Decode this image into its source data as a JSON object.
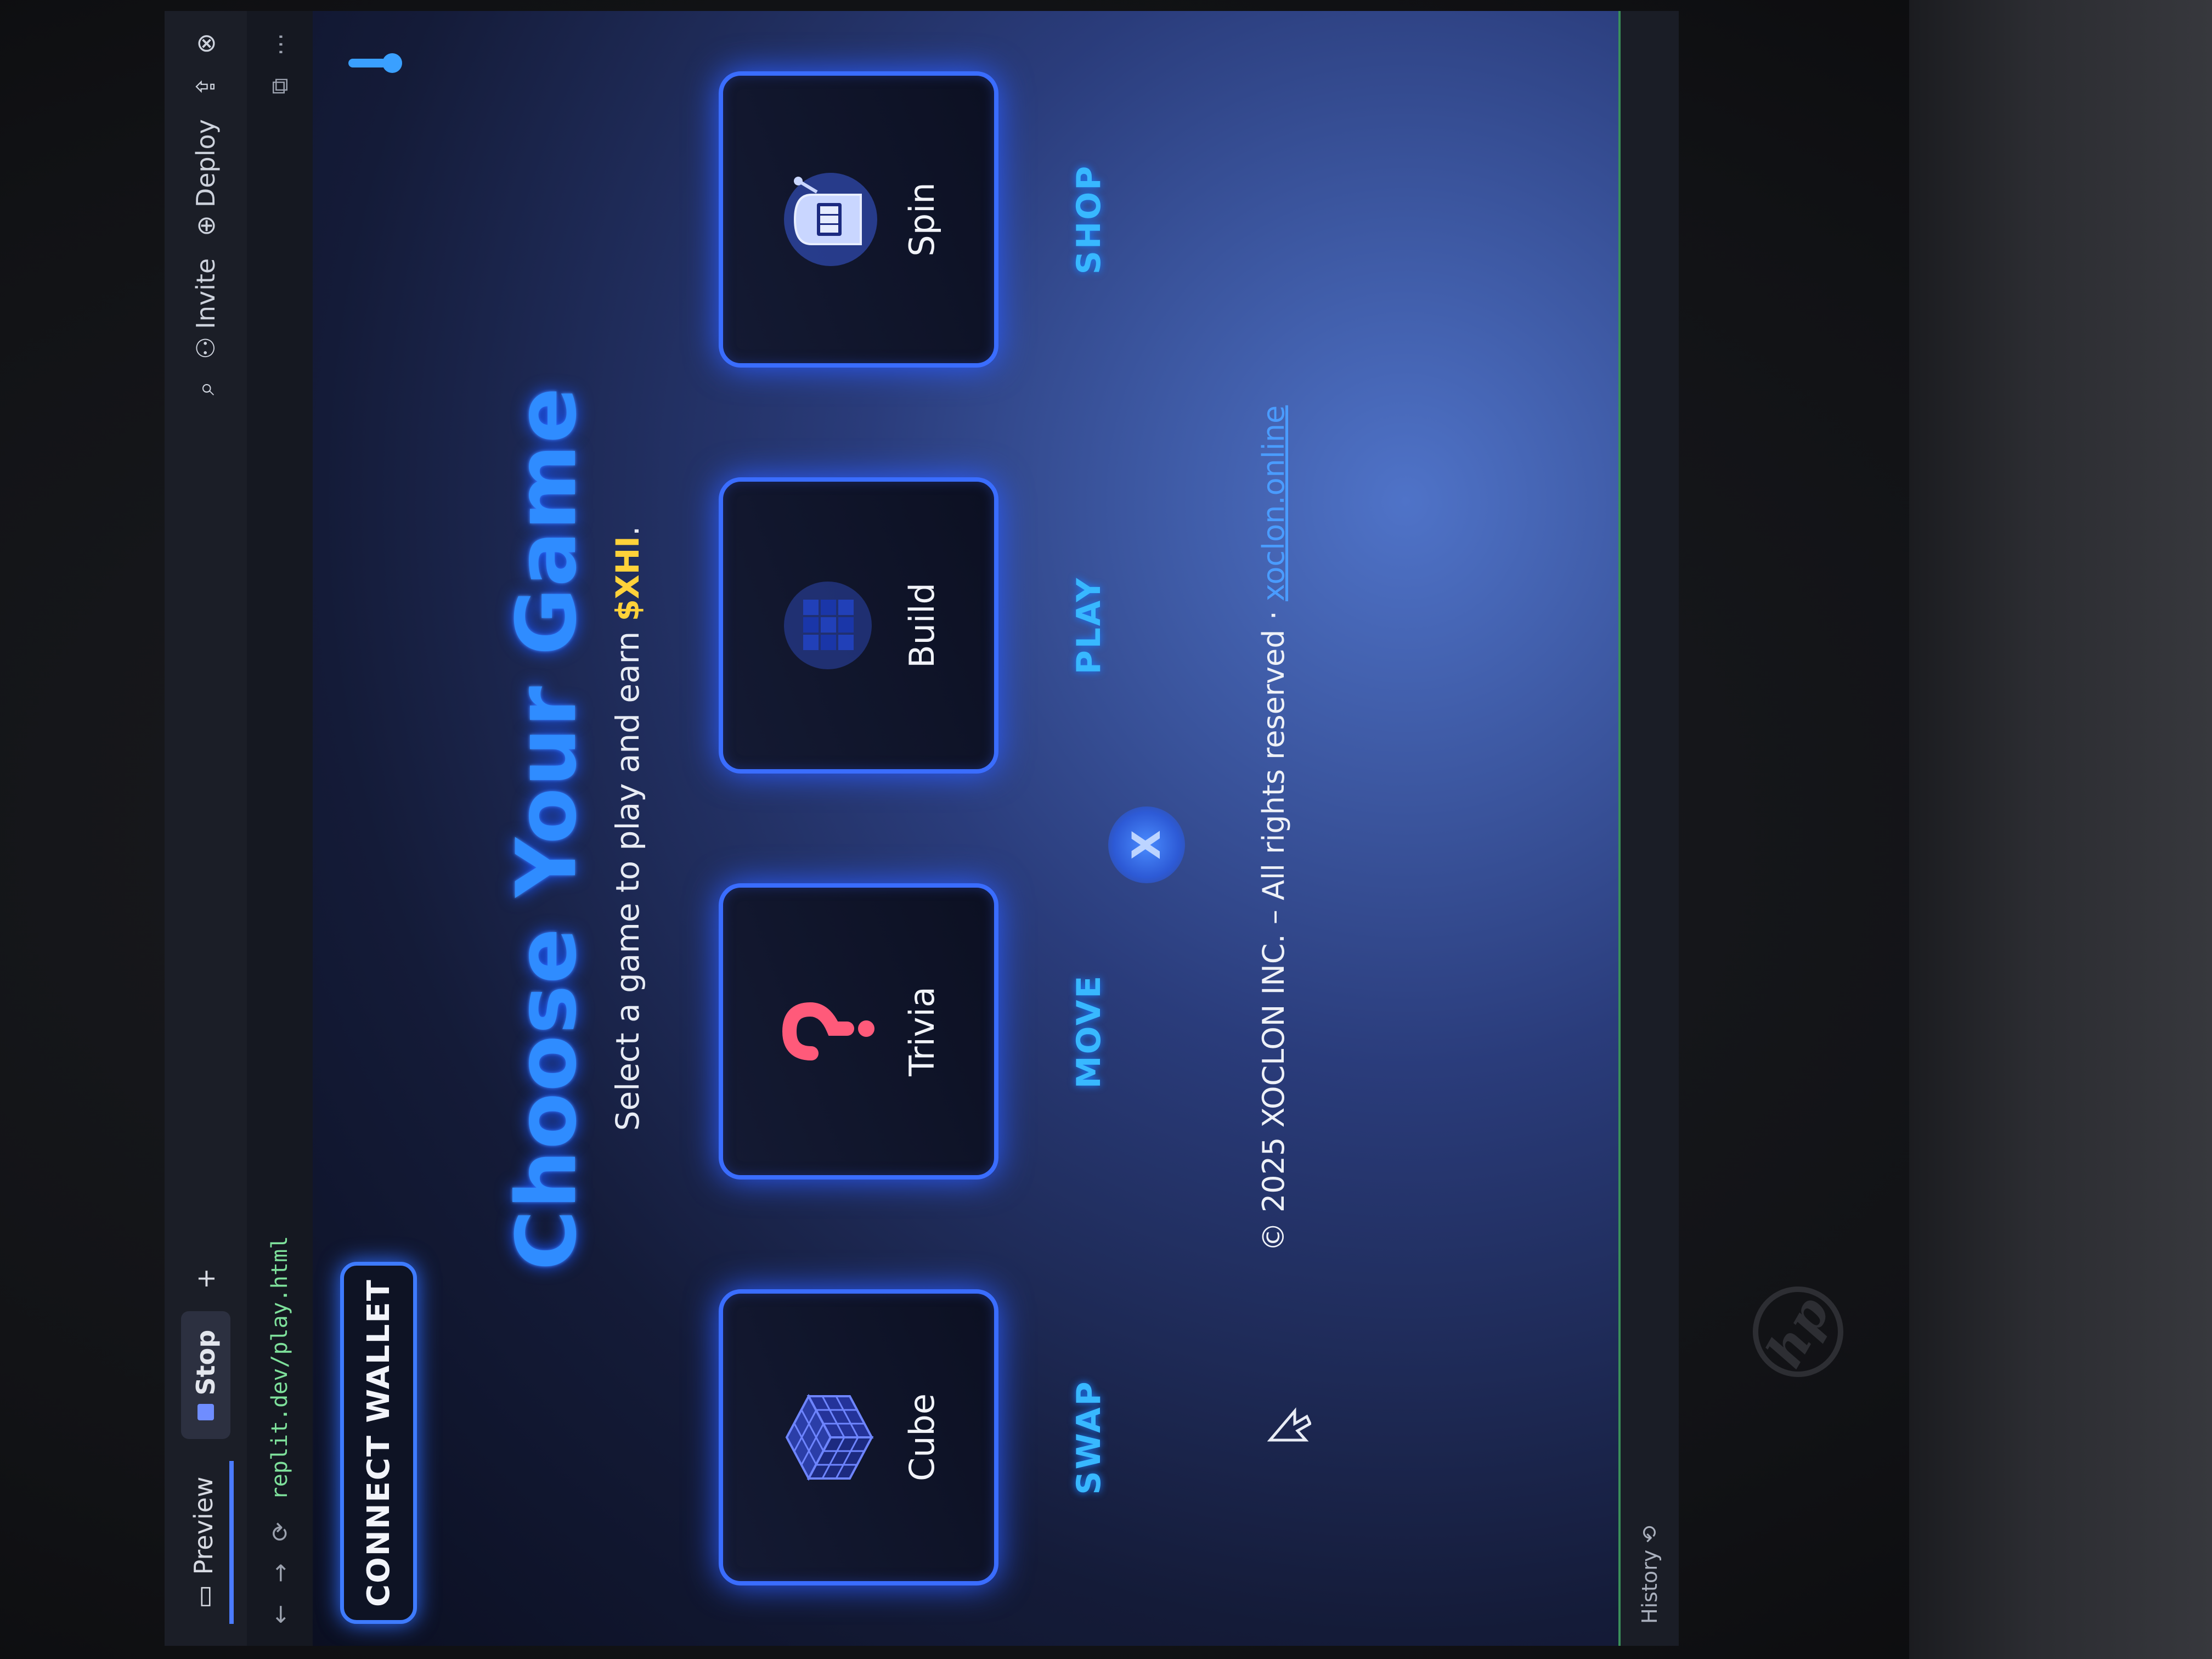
{
  "ide": {
    "preview_tab": "Preview",
    "stop_label": "Stop",
    "invite_label": "Invite",
    "deploy_label": "Deploy",
    "url": "replit.dev/play.html",
    "history_label": "History"
  },
  "app": {
    "connect_wallet_label": "CONNECT WALLET",
    "heading": "Choose Your Game",
    "subheading_prefix": "Select a game to play and earn ",
    "subheading_token": "$XHI",
    "subheading_suffix": ".",
    "games": [
      {
        "label": "Cube",
        "icon": "cube-icon"
      },
      {
        "label": "Trivia",
        "icon": "question-mark-icon"
      },
      {
        "label": "Build",
        "icon": "blocks-icon"
      },
      {
        "label": "Spin",
        "icon": "slot-machine-icon"
      }
    ],
    "nav": [
      "SWAP",
      "MOVE",
      "PLAY",
      "SHOP"
    ],
    "footer_text": "© 2025 XOCLON INC. – All rights reserved · ",
    "footer_link": "xoclon.online"
  },
  "colors": {
    "accent": "#3a6dff",
    "heading": "#2f8cff",
    "nav": "#38b8ff",
    "token": "#ffd23a"
  }
}
